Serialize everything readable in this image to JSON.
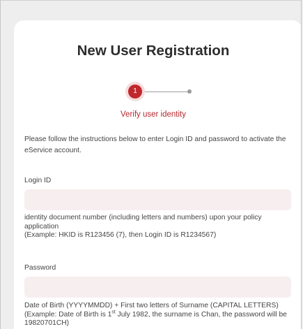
{
  "page": {
    "title": "New User Registration"
  },
  "stepper": {
    "current_step": "1",
    "caption": "Verify user identity"
  },
  "intro_text": "Please follow the instructions below to enter Login ID and password to activate the eService account.",
  "login_id": {
    "label": "Login ID",
    "value": "",
    "help_line1": "identity document number (including letters and numbers) upon your policy application",
    "help_line2": "(Example: HKID is R123456 (7), then Login ID is R1234567)"
  },
  "password": {
    "label": "Password",
    "value": "",
    "help_line1": "Date of Birth (YYYYMMDD) + First two letters of Surname (CAPITAL LETTERS)",
    "help_line2_before": "(Example: Date of Birth is 1",
    "help_line2_sup": "st",
    "help_line2_after": " July 1982, the surname is Chan, the password will be 19820701CH)"
  },
  "colors": {
    "accent": "#c0282d",
    "input_bg": "#f7eef0",
    "card_bg": "#ffffff",
    "page_bg": "#eeeeee"
  }
}
